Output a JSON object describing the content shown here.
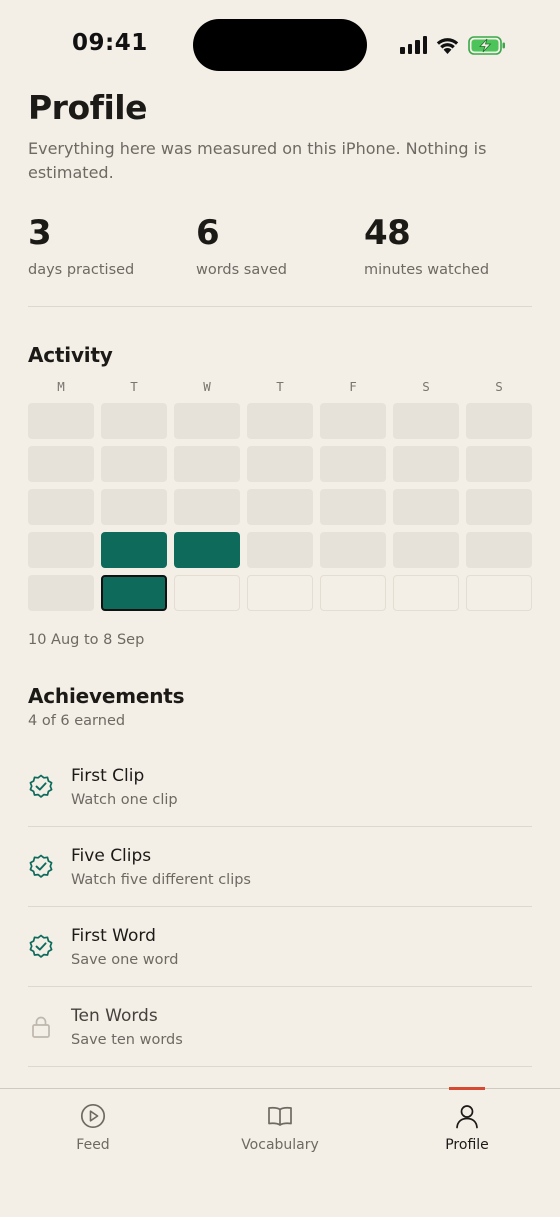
{
  "status_bar": {
    "time": "09:41"
  },
  "profile": {
    "title": "Profile",
    "subtitle": "Everything here was measured on this iPhone. Nothing is estimated."
  },
  "stats": [
    {
      "value": "3",
      "label": "days practised"
    },
    {
      "value": "6",
      "label": "words saved"
    },
    {
      "value": "48",
      "label": "minutes watched"
    }
  ],
  "activity": {
    "title": "Activity",
    "weekdays": [
      "M",
      "T",
      "W",
      "T",
      "F",
      "S",
      "S"
    ],
    "grid": [
      [
        "none",
        "none",
        "none",
        "none",
        "none",
        "none",
        "none"
      ],
      [
        "none",
        "none",
        "none",
        "none",
        "none",
        "none",
        "none"
      ],
      [
        "none",
        "none",
        "none",
        "none",
        "none",
        "none",
        "none"
      ],
      [
        "none",
        "active",
        "active",
        "none",
        "none",
        "none",
        "none"
      ],
      [
        "none",
        "active-today",
        "future",
        "future",
        "future",
        "future",
        "future"
      ]
    ],
    "range": "10 Aug to 8 Sep",
    "colors": {
      "active": "#0e6b5c",
      "empty": "#e6e1d9"
    }
  },
  "achievements": {
    "title": "Achievements",
    "count": "4 of 6 earned",
    "items": [
      {
        "name": "First Clip",
        "description": "Watch one clip",
        "earned": true,
        "icon": "badge-check-icon"
      },
      {
        "name": "Five Clips",
        "description": "Watch five different clips",
        "earned": true,
        "icon": "badge-check-icon"
      },
      {
        "name": "First Word",
        "description": "Save one word",
        "earned": true,
        "icon": "badge-check-icon"
      },
      {
        "name": "Ten Words",
        "description": "Save ten words",
        "earned": false,
        "icon": "lock-icon"
      }
    ]
  },
  "tabs": [
    {
      "label": "Feed",
      "icon": "play-circle-icon",
      "selected": false
    },
    {
      "label": "Vocabulary",
      "icon": "open-book-icon",
      "selected": false
    },
    {
      "label": "Profile",
      "icon": "person-icon",
      "selected": true
    }
  ]
}
